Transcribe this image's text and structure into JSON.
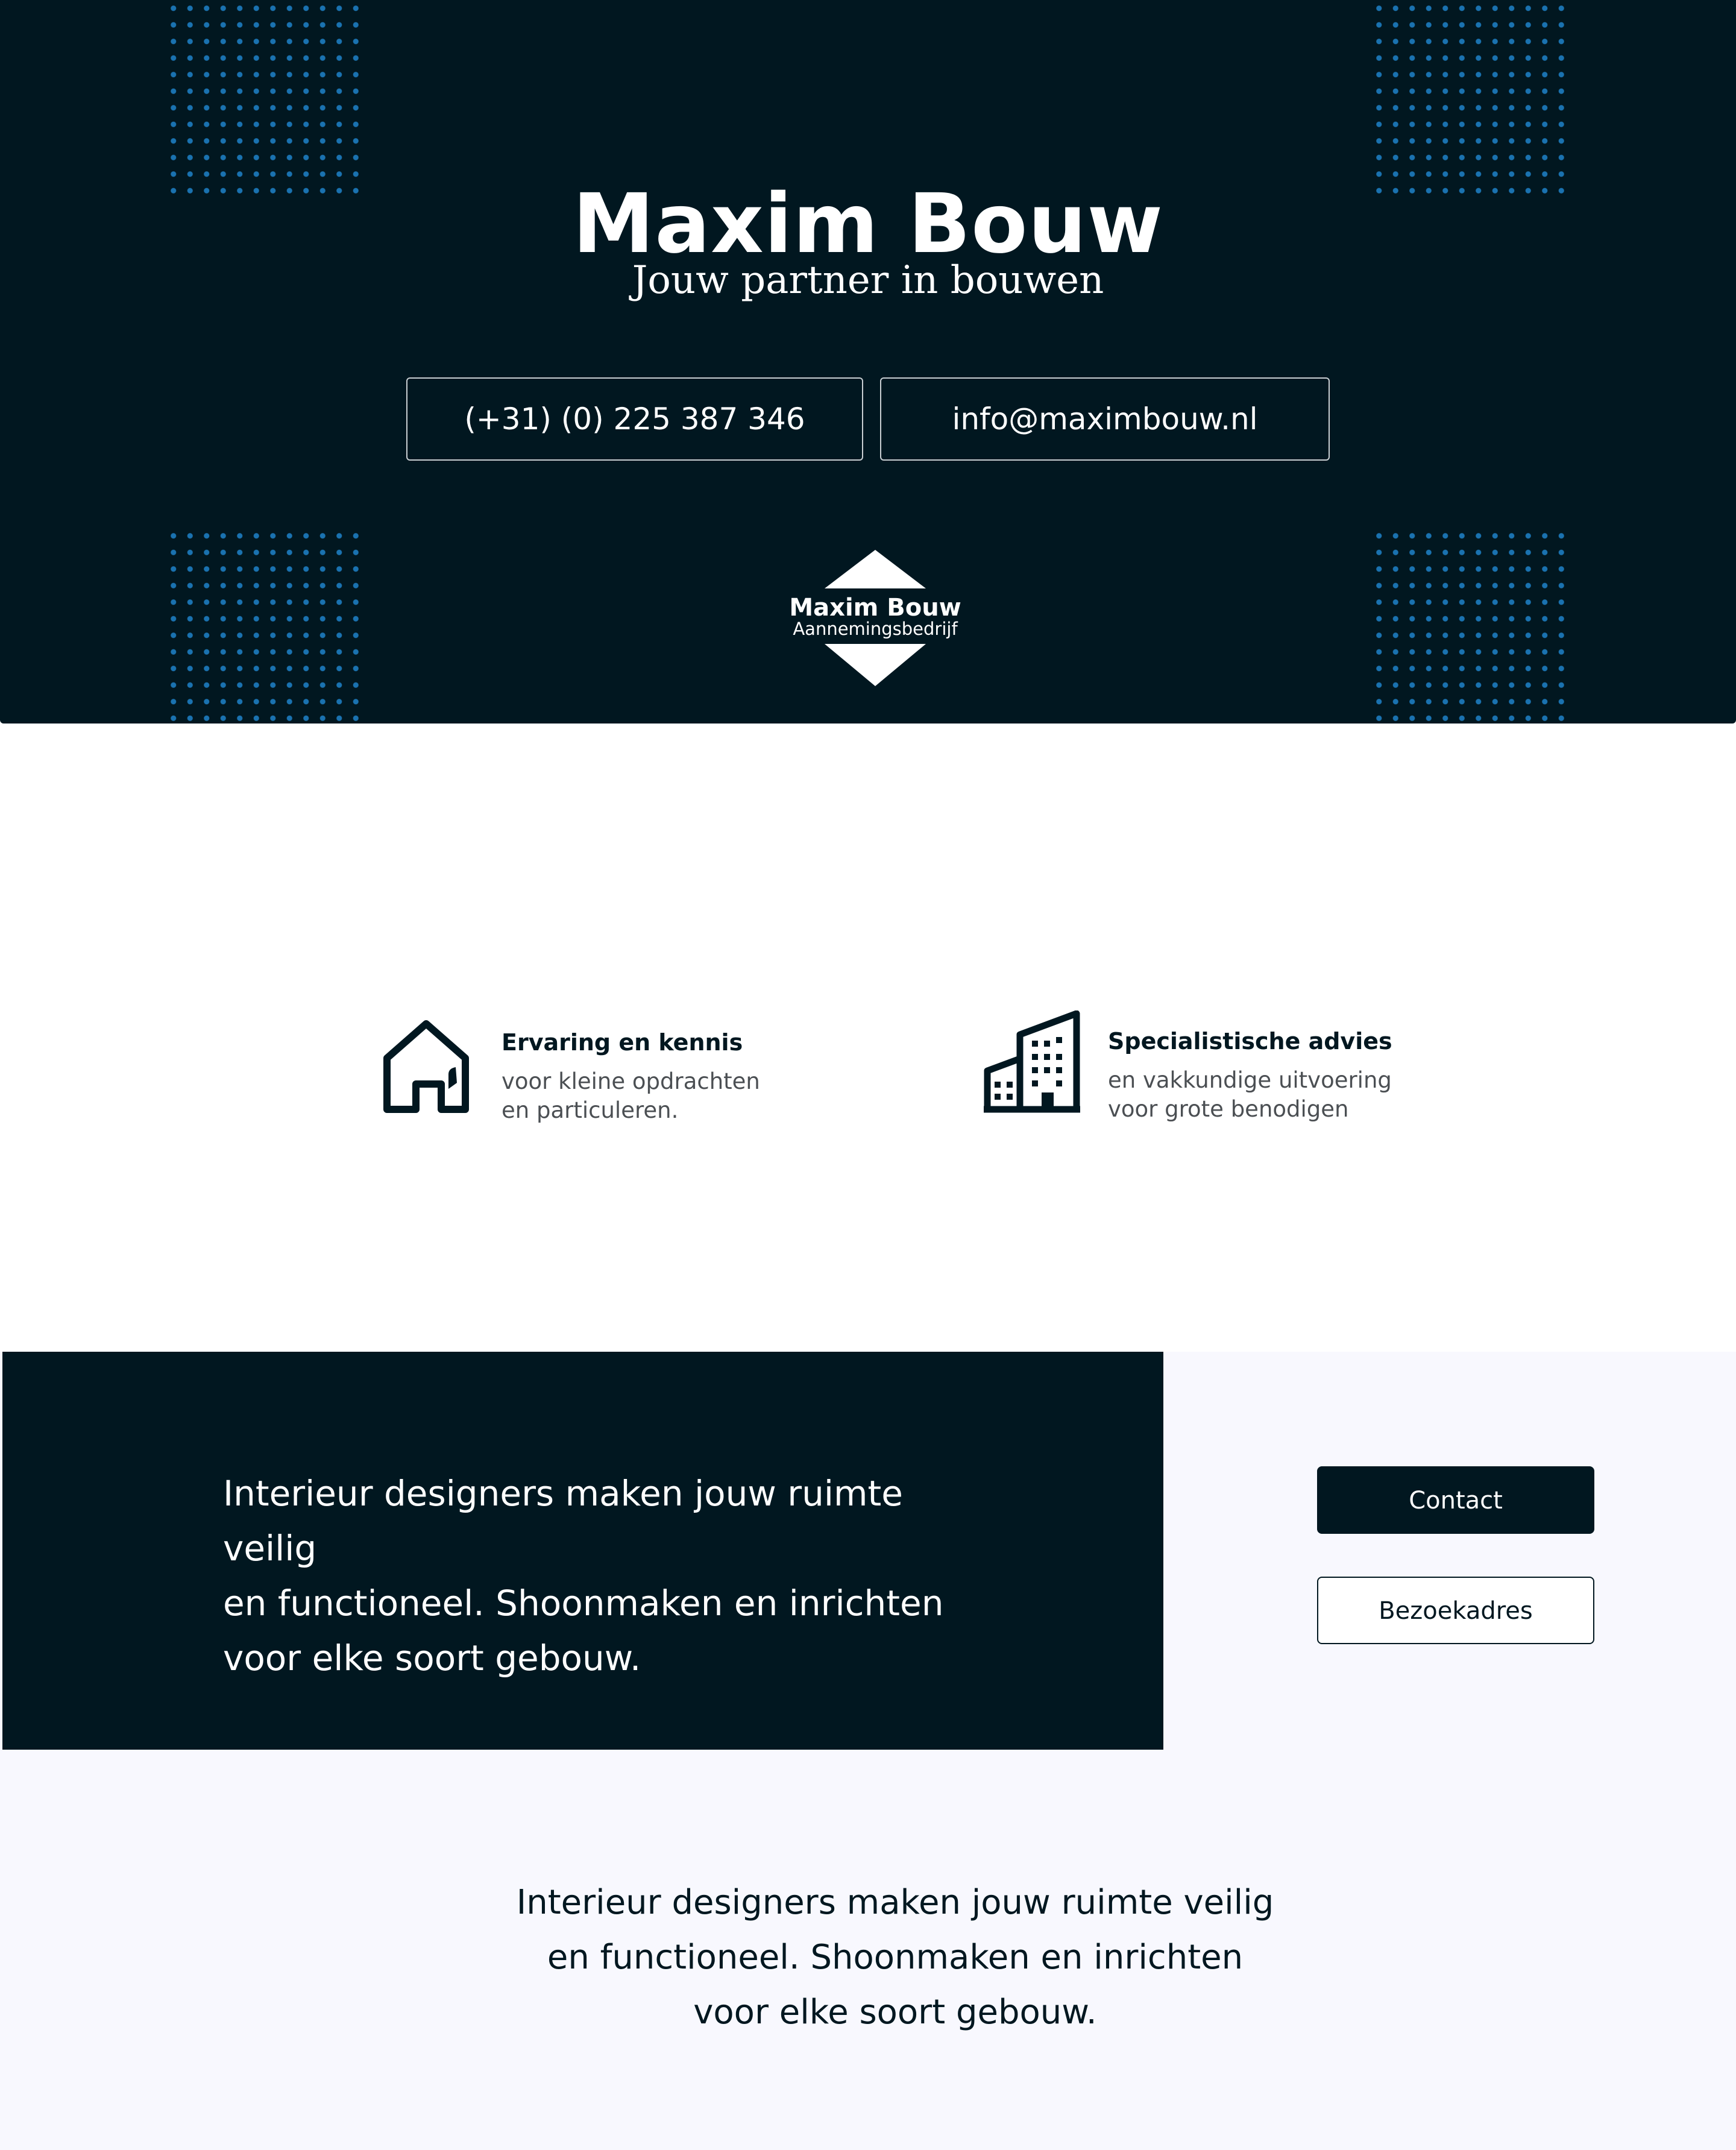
{
  "hero": {
    "title": "Maxim Bouw",
    "subtitle": "Jouw partner in bouwen",
    "phone": "(+31) (0) 225 387 346",
    "email": "info@maximbouw.nl",
    "logo": {
      "name": "Maxim Bouw",
      "tagline": "Aannemingsbedrijf"
    }
  },
  "features": [
    {
      "icon": "house-icon",
      "title": "Ervaring en kennis",
      "description": "voor kleine opdrachten\nen particuleren."
    },
    {
      "icon": "buildings-icon",
      "title": "Specialistische advies",
      "description": "en vakkundige uitvoering\nvoor grote benodigen"
    }
  ],
  "cta": {
    "text": "Interieur designers maken jouw ruimte veilig\nen functioneel. Shoonmaken en inrichten\nvoor elke soort gebouw.",
    "contact_label": "Contact",
    "visit_label": "Bezoekadres"
  },
  "bottom": {
    "text": "Interieur designers maken jouw ruimte veilig\nen functioneel. Shoonmaken en inrichten\nvoor elke soort gebouw."
  },
  "colors": {
    "dark": "#011720",
    "dots": "#1a72b0",
    "light_bg": "#f8f8fe"
  }
}
